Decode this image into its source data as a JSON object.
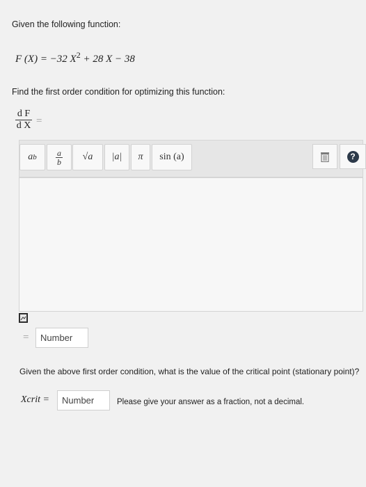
{
  "question": {
    "intro": "Given the following function:",
    "function": {
      "lhs": "F (X) = ",
      "term1": "−32 X",
      "exp": "2",
      "rest": " + 28 X − 38"
    },
    "instruction": "Find the first order condition for optimizing this function:",
    "derivative": {
      "numerator": "d F",
      "denominator": "d X",
      "equals": "="
    }
  },
  "toolbar": {
    "power": {
      "base": "a",
      "exp": "b"
    },
    "fraction": {
      "num": "a",
      "den": "b"
    },
    "sqrt": "√a",
    "abs": "|a|",
    "pi": "π",
    "sin": "sin (a)",
    "trash_icon": "trash-icon",
    "help_label": "?"
  },
  "answer1": {
    "equals": "=",
    "placeholder": "Number"
  },
  "question2": "Given the above first order condition, what is the value of the critical point (stationary point)?",
  "answer2": {
    "label": "Xcrit =",
    "placeholder": "Number",
    "note": "Please give your answer as a fraction, not a decimal."
  },
  "colors": {
    "background": "#f1f1f1",
    "toolbar": "#e6e6e6",
    "help_bg": "#2d3a4a"
  }
}
